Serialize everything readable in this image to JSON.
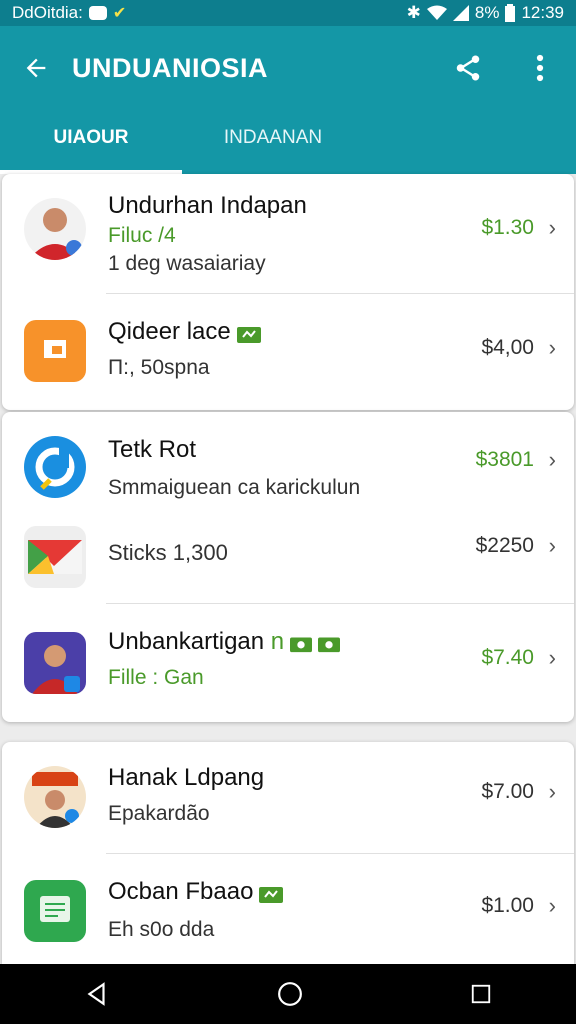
{
  "status_bar": {
    "left_text": "DdOitdia:",
    "right_text": "8%",
    "time": "12:39"
  },
  "app_bar": {
    "title": "UNDUANIOSIA"
  },
  "tabs": [
    {
      "label": "UIAOUR"
    },
    {
      "label": "INDAANAN"
    }
  ],
  "items": [
    {
      "name": "Undurhan Indapan",
      "sub1": "Filuc /4",
      "sub2": "1 deg wasaiariay",
      "price": "$1.30"
    },
    {
      "name": "Qideer lace",
      "sub1": "Π:, 50spna",
      "price": "$4,00"
    },
    {
      "name": "Tetk Rot",
      "sub1": "Smmaiguean ca karickulun",
      "price": "$3801"
    },
    {
      "name": "",
      "sub1": "Sticks 1,300",
      "price": "$2250"
    },
    {
      "name": "Unbankartigan",
      "badge": "n",
      "sub1": "Fille : Gan",
      "price": "$7.40"
    },
    {
      "name": "Hanak Ldpang",
      "sub1": "Epakardão",
      "price": "$7.00"
    },
    {
      "name": "Ocban Fbaao",
      "sub1": "Eh s0o dda",
      "price": "$1.00"
    }
  ],
  "colors": {
    "primary": "#1497a6",
    "status_bar": "#0d7e8e",
    "price_green": "#4a9a2a"
  },
  "icons": [
    "back-arrow-icon",
    "share-icon",
    "more-vert-icon",
    "bluetooth-icon",
    "wifi-icon",
    "battery-icon",
    "shop-bag-icon",
    "chevron-right-icon",
    "nav-back-icon",
    "nav-home-icon",
    "nav-recents-icon"
  ]
}
